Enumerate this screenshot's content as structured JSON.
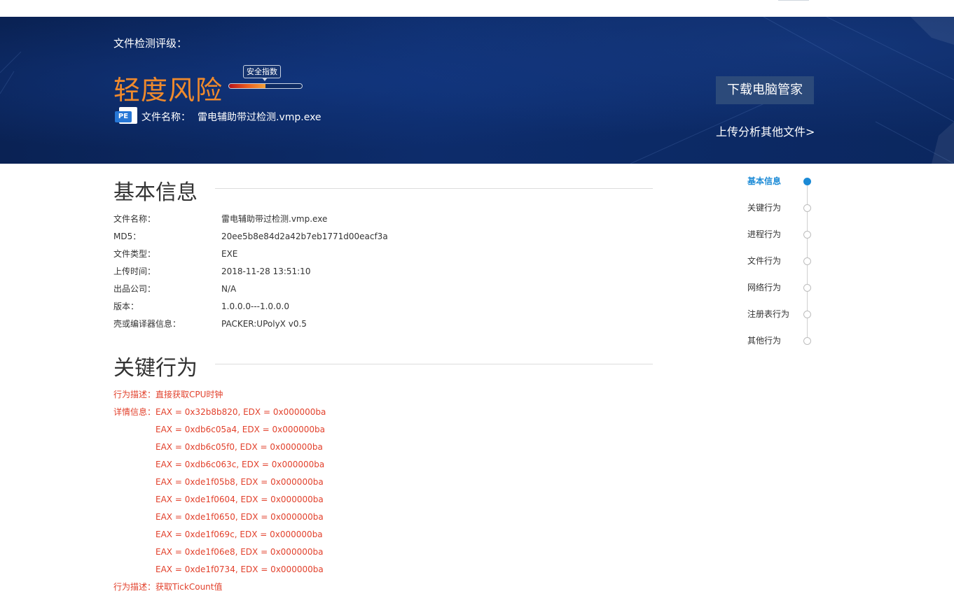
{
  "header": {
    "rating_label": "文件检测评级：",
    "risk_level": "轻度风险",
    "meter_label": "安全指数",
    "meter_level": 0.5,
    "filename_label": "文件名称：",
    "filename_value": "雷电辅助带过检测.vmp.exe",
    "download_button": "下载电脑管家",
    "upload_link": "上传分析其他文件>",
    "pe_icon_text": "PE"
  },
  "basic_info": {
    "title": "基本信息",
    "rows": [
      {
        "key": "文件名称：",
        "value": "雷电辅助带过检测.vmp.exe"
      },
      {
        "key": "MD5：",
        "value": "20ee5b8e84d2a42b7eb1771d00eacf3a"
      },
      {
        "key": "文件类型：",
        "value": "EXE"
      },
      {
        "key": "上传时间：",
        "value": "2018-11-28 13:51:10"
      },
      {
        "key": "出品公司：",
        "value": "N/A"
      },
      {
        "key": "版本：",
        "value": "1.0.0.0---1.0.0.0"
      },
      {
        "key": "壳或编译器信息：",
        "value": "PACKER:UPolyX v0.5"
      }
    ]
  },
  "key_behavior": {
    "title": "关键行为",
    "desc_label": "行为描述：",
    "detail_label": "详情信息：",
    "item1_desc": "直接获取CPU时钟",
    "details": [
      "EAX = 0x32b8b820, EDX = 0x000000ba",
      "EAX = 0xdb6c05a4, EDX = 0x000000ba",
      "EAX = 0xdb6c05f0, EDX = 0x000000ba",
      "EAX = 0xdb6c063c, EDX = 0x000000ba",
      "EAX = 0xde1f05b8, EDX = 0x000000ba",
      "EAX = 0xde1f0604, EDX = 0x000000ba",
      "EAX = 0xde1f0650, EDX = 0x000000ba",
      "EAX = 0xde1f069c, EDX = 0x000000ba",
      "EAX = 0xde1f06e8, EDX = 0x000000ba",
      "EAX = 0xde1f0734, EDX = 0x000000ba"
    ],
    "item2_desc": "获取TickCount值"
  },
  "side_nav": {
    "items": [
      "基本信息",
      "关键行为",
      "进程行为",
      "文件行为",
      "网络行为",
      "注册表行为",
      "其他行为"
    ],
    "active_index": 0
  },
  "colors": {
    "banner": "#0b275f",
    "risk": "#f08a2c",
    "behavior_text": "#e2412c",
    "nav_active": "#1b8ad6"
  }
}
